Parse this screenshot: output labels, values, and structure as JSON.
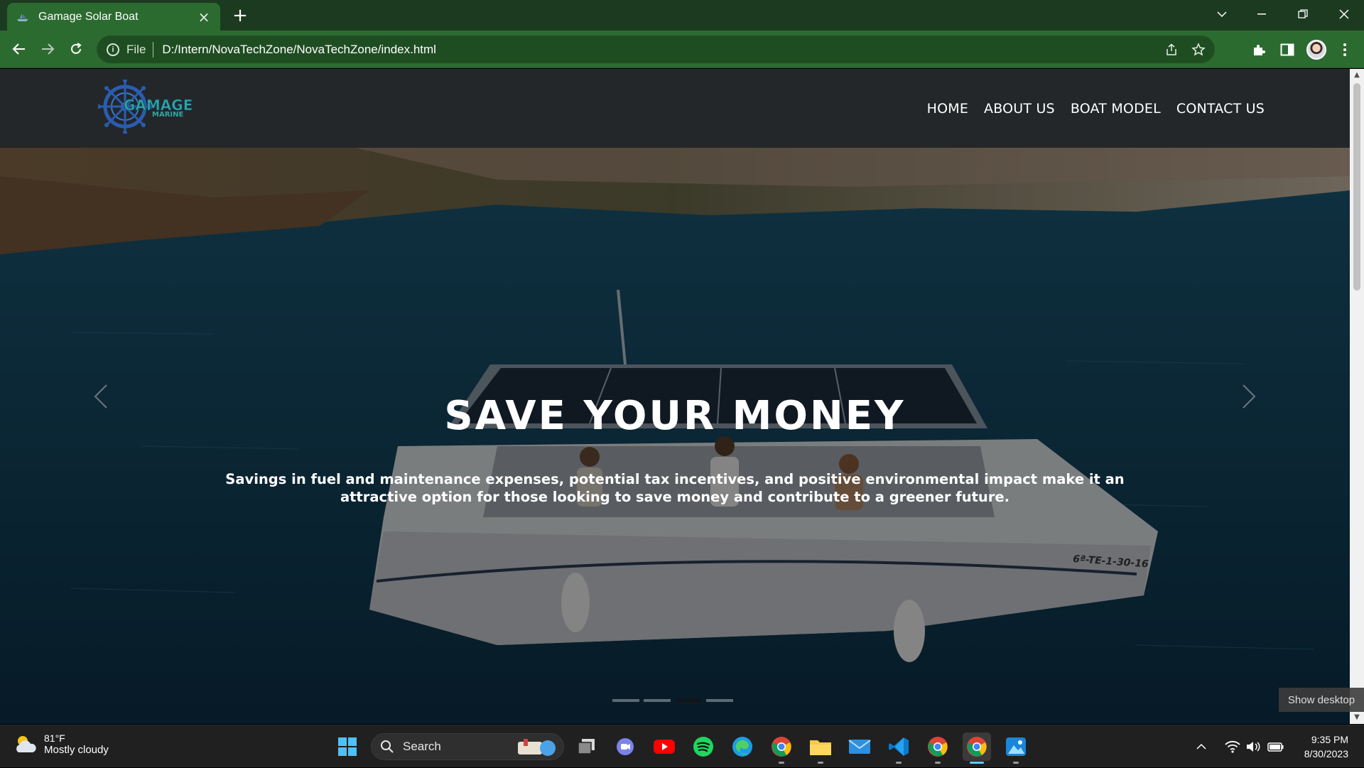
{
  "browser": {
    "tab_title": "Gamage Solar Boat",
    "new_tab_label": "+",
    "scheme_label": "File",
    "url": "D:/Intern/NovaTechZone/NovaTechZone/index.html"
  },
  "site": {
    "nav": [
      "HOME",
      "ABOUT US",
      "BOAT MODEL",
      "CONTACT US"
    ],
    "logo_text": "GAMAGE",
    "logo_subtext": "MARINE"
  },
  "hero": {
    "title": "SAVE YOUR MONEY",
    "text": "Savings in fuel and maintenance expenses, potential tax incentives, and positive environmental impact make it an attractive option for those looking to save money and contribute to a greener future.",
    "boat_registration": "6ª-TE-1-30-16",
    "slides": 4,
    "active_slide": 3
  },
  "tooltip": {
    "show_desktop": "Show desktop"
  },
  "taskbar": {
    "weather_temp": "81°F",
    "weather_condition": "Mostly cloudy",
    "search_label": "Search",
    "time": "9:35 PM",
    "date": "8/30/2023"
  },
  "colors": {
    "tab_active": "#2c6b30",
    "tabbar": "#1c3a1f",
    "site_header": "#23272a",
    "taskbar": "#202020"
  }
}
